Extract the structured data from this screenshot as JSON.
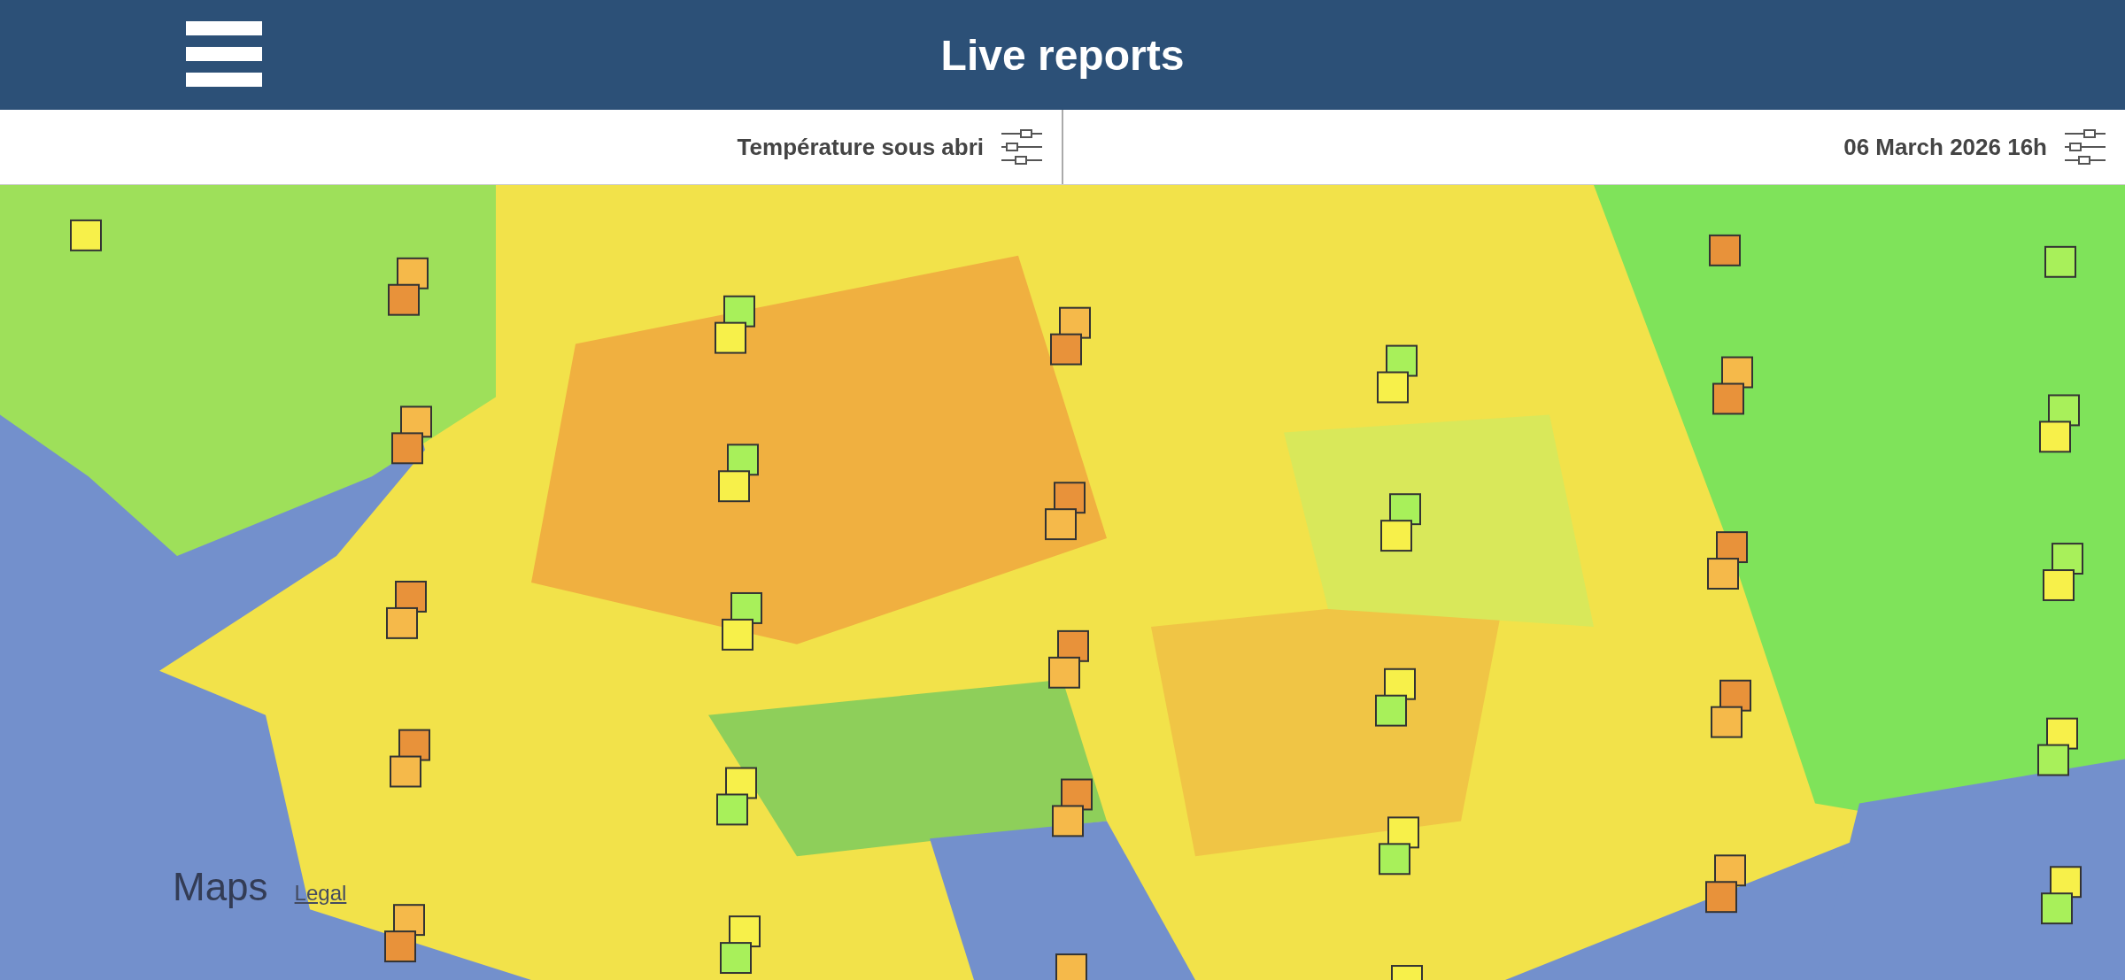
{
  "header": {
    "title": "Live reports"
  },
  "filters": [
    {
      "label": "Température sous abri"
    },
    {
      "label": "06 March 2026 16h"
    }
  ],
  "map": {
    "kind": "picture",
    "attribution": "Maps",
    "legal_link": "Legal"
  }
}
